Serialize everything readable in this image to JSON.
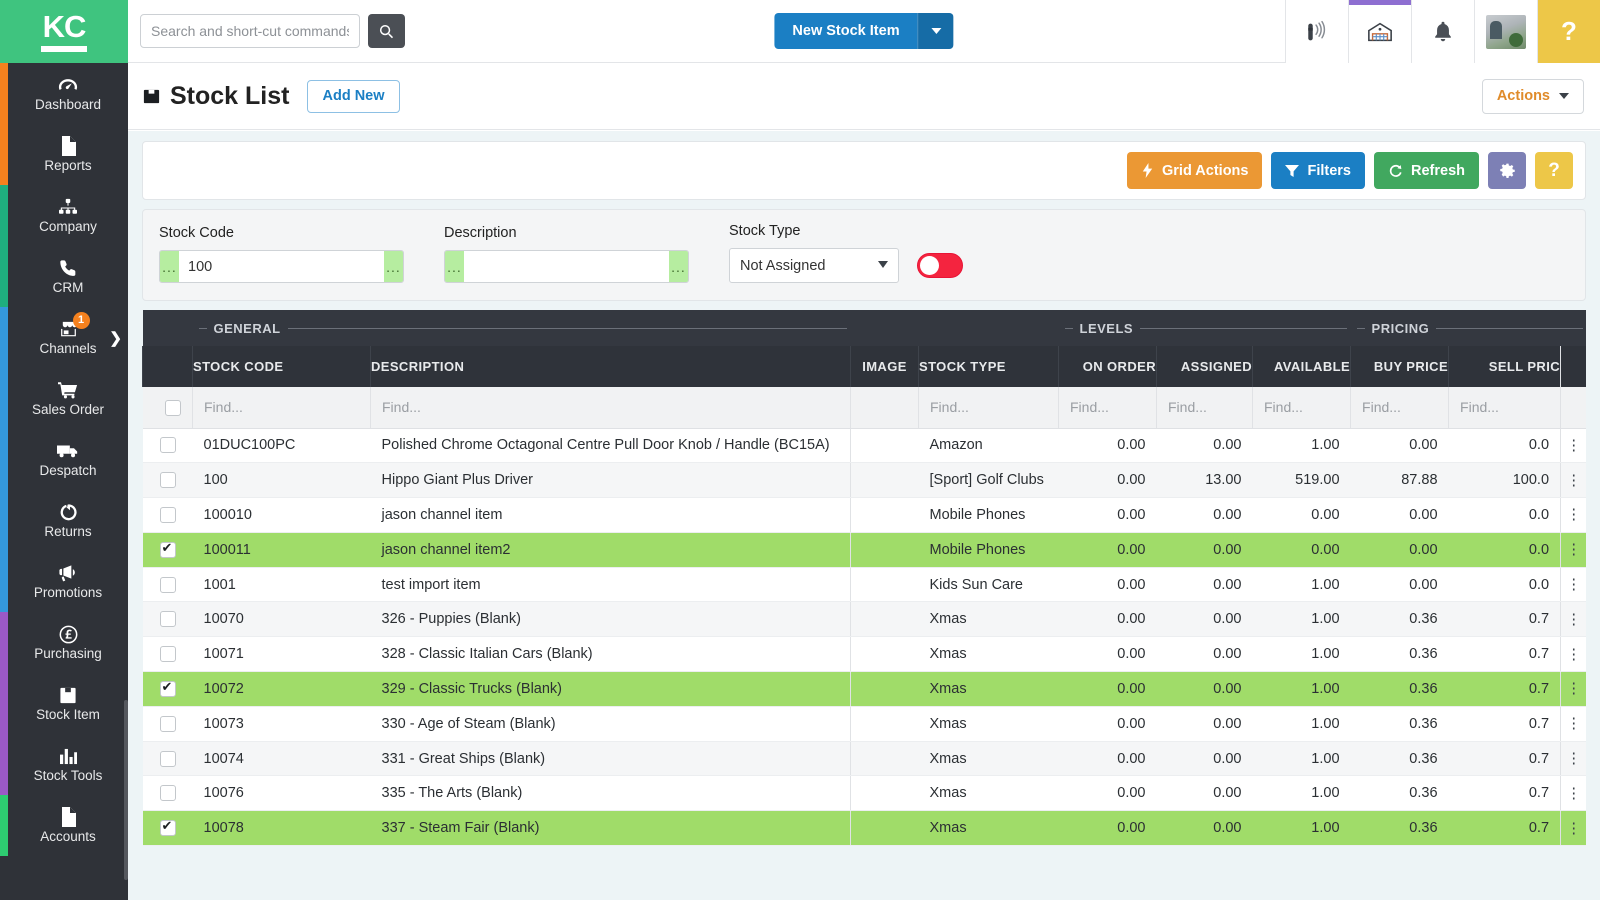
{
  "brand": {
    "logo_text": "KC"
  },
  "sidebar": {
    "items": [
      {
        "label": "Dashboard",
        "icon": "gauge-icon",
        "accent": "#f5811e",
        "badge": null
      },
      {
        "label": "Reports",
        "icon": "document-icon",
        "accent": "#f5811e",
        "badge": null
      },
      {
        "label": "Company",
        "icon": "sitemap-icon",
        "accent": "#1fae7e",
        "badge": null
      },
      {
        "label": "CRM",
        "icon": "phone-icon",
        "accent": "#1fae7e",
        "badge": null
      },
      {
        "label": "Channels",
        "icon": "store-icon",
        "accent": "#3498db",
        "badge": "1"
      },
      {
        "label": "Sales Order",
        "icon": "cart-icon",
        "accent": "#3498db",
        "badge": null
      },
      {
        "label": "Despatch",
        "icon": "truck-icon",
        "accent": "#3498db",
        "badge": null
      },
      {
        "label": "Returns",
        "icon": "undo-icon",
        "accent": "#3498db",
        "badge": null
      },
      {
        "label": "Promotions",
        "icon": "megaphone-icon",
        "accent": "#3498db",
        "badge": null
      },
      {
        "label": "Purchasing",
        "icon": "pound-coin-icon",
        "accent": "#9b59c6",
        "badge": null
      },
      {
        "label": "Stock Item",
        "icon": "box-icon",
        "accent": "#9b59c6",
        "badge": null
      },
      {
        "label": "Stock Tools",
        "icon": "bar-chart-icon",
        "accent": "#9b59c6",
        "badge": null
      },
      {
        "label": "Accounts",
        "icon": "document-icon",
        "accent": "#2ecc71",
        "badge": null
      }
    ]
  },
  "topbar": {
    "search_placeholder": "Search and short-cut commands",
    "search_value": "",
    "search_icon": "search-icon",
    "new_stock_label": "New Stock Item",
    "icons": [
      {
        "name": "barcode-scanner-icon"
      },
      {
        "name": "warehouse-icon"
      },
      {
        "name": "bell-icon"
      },
      {
        "name": "user-avatar"
      }
    ],
    "help_label": "?"
  },
  "page": {
    "title": "Stock List",
    "title_icon": "box-icon",
    "add_new_label": "Add New",
    "actions_label": "Actions"
  },
  "toolbar": {
    "grid_actions_label": "Grid Actions",
    "filters_label": "Filters",
    "refresh_label": "Refresh",
    "settings_label": "",
    "help_label": "?"
  },
  "filters": {
    "stock_code": {
      "label": "Stock Code",
      "value": "100",
      "placeholder": "",
      "addon": "..."
    },
    "description": {
      "label": "Description",
      "value": "",
      "placeholder": "",
      "addon": "..."
    },
    "stock_type": {
      "label": "Stock Type",
      "value": "Not Assigned",
      "options": [
        "Not Assigned"
      ]
    },
    "toggle_on": true
  },
  "grid": {
    "groups": [
      {
        "label": "GENERAL",
        "span": 3
      },
      {
        "label": "",
        "span": 2
      },
      {
        "label": "LEVELS",
        "span": 3
      },
      {
        "label": "PRICING",
        "span": 2
      }
    ],
    "columns": [
      {
        "key": "code",
        "label": "STOCK CODE",
        "align": "left"
      },
      {
        "key": "desc",
        "label": "DESCRIPTION",
        "align": "left"
      },
      {
        "key": "image",
        "label": "IMAGE",
        "align": "center"
      },
      {
        "key": "type",
        "label": "STOCK TYPE",
        "align": "left"
      },
      {
        "key": "on_order",
        "label": "ON ORDER",
        "align": "right"
      },
      {
        "key": "assigned",
        "label": "ASSIGNED",
        "align": "right"
      },
      {
        "key": "available",
        "label": "AVAILABLE",
        "align": "right"
      },
      {
        "key": "buy",
        "label": "BUY PRICE",
        "align": "right"
      },
      {
        "key": "sell",
        "label": "SELL PRIC",
        "align": "right"
      }
    ],
    "find_placeholder": "Find...",
    "kebab_glyph": "⋮",
    "rows": [
      {
        "checked": false,
        "code": "01DUC100PC",
        "desc": "Polished Chrome Octagonal Centre Pull Door Knob / Handle (BC15A)",
        "type": "Amazon",
        "on_order": "0.00",
        "assigned": "0.00",
        "available": "1.00",
        "buy": "0.00",
        "sell": "0.0"
      },
      {
        "checked": false,
        "code": "100",
        "desc": "Hippo Giant Plus Driver",
        "type": "[Sport] Golf Clubs",
        "on_order": "0.00",
        "assigned": "13.00",
        "available": "519.00",
        "buy": "87.88",
        "sell": "100.0"
      },
      {
        "checked": false,
        "code": "100010",
        "desc": "jason channel item",
        "type": "Mobile Phones",
        "on_order": "0.00",
        "assigned": "0.00",
        "available": "0.00",
        "buy": "0.00",
        "sell": "0.0"
      },
      {
        "checked": true,
        "code": "100011",
        "desc": "jason channel item2",
        "type": "Mobile Phones",
        "on_order": "0.00",
        "assigned": "0.00",
        "available": "0.00",
        "buy": "0.00",
        "sell": "0.0"
      },
      {
        "checked": false,
        "code": "1001",
        "desc": "test import item",
        "type": "Kids Sun Care",
        "on_order": "0.00",
        "assigned": "0.00",
        "available": "1.00",
        "buy": "0.00",
        "sell": "0.0"
      },
      {
        "checked": false,
        "code": "10070",
        "desc": "326 - Puppies (Blank)",
        "type": "Xmas",
        "on_order": "0.00",
        "assigned": "0.00",
        "available": "1.00",
        "buy": "0.36",
        "sell": "0.7"
      },
      {
        "checked": false,
        "code": "10071",
        "desc": "328 - Classic Italian Cars (Blank)",
        "type": "Xmas",
        "on_order": "0.00",
        "assigned": "0.00",
        "available": "1.00",
        "buy": "0.36",
        "sell": "0.7"
      },
      {
        "checked": true,
        "code": "10072",
        "desc": "329 - Classic Trucks (Blank)",
        "type": "Xmas",
        "on_order": "0.00",
        "assigned": "0.00",
        "available": "1.00",
        "buy": "0.36",
        "sell": "0.7"
      },
      {
        "checked": false,
        "code": "10073",
        "desc": "330 - Age of Steam (Blank)",
        "type": "Xmas",
        "on_order": "0.00",
        "assigned": "0.00",
        "available": "1.00",
        "buy": "0.36",
        "sell": "0.7"
      },
      {
        "checked": false,
        "code": "10074",
        "desc": "331 - Great Ships (Blank)",
        "type": "Xmas",
        "on_order": "0.00",
        "assigned": "0.00",
        "available": "1.00",
        "buy": "0.36",
        "sell": "0.7"
      },
      {
        "checked": false,
        "code": "10076",
        "desc": "335 - The Arts (Blank)",
        "type": "Xmas",
        "on_order": "0.00",
        "assigned": "0.00",
        "available": "1.00",
        "buy": "0.36",
        "sell": "0.7"
      },
      {
        "checked": true,
        "code": "10078",
        "desc": "337 - Steam Fair (Blank)",
        "type": "Xmas",
        "on_order": "0.00",
        "assigned": "0.00",
        "available": "1.00",
        "buy": "0.36",
        "sell": "0.7"
      }
    ]
  },
  "colors": {
    "brand_green": "#3fc47f",
    "sidebar_bg": "#2f3238",
    "primary_blue": "#1b7fc4",
    "grid_header": "#2f333a",
    "selected_row": "#a0dc69",
    "toggle_red": "#f4243f",
    "help_yellow": "#edc748"
  }
}
